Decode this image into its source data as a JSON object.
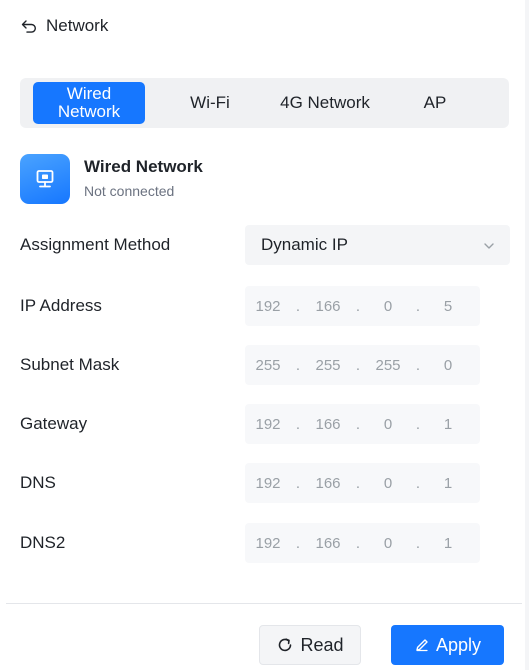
{
  "header": {
    "title": "Network",
    "back_icon": "back-arrow-icon"
  },
  "tabs": [
    {
      "label_line1": "Wired",
      "label_line2": "Network",
      "active": true
    },
    {
      "label": "Wi-Fi",
      "active": false
    },
    {
      "label": "4G Network",
      "active": false
    },
    {
      "label": "AP",
      "active": false
    }
  ],
  "network": {
    "icon": "wired-network-icon",
    "title": "Wired Network",
    "status": "Not connected"
  },
  "assignment": {
    "label": "Assignment Method",
    "value": "Dynamic IP",
    "icon": "chevron-down-icon"
  },
  "fields": [
    {
      "label": "IP Address",
      "octets": [
        "192",
        "166",
        "0",
        "5"
      ]
    },
    {
      "label": "Subnet Mask",
      "octets": [
        "255",
        "255",
        "255",
        "0"
      ]
    },
    {
      "label": "Gateway",
      "octets": [
        "192",
        "166",
        "0",
        "1"
      ]
    },
    {
      "label": "DNS",
      "octets": [
        "192",
        "166",
        "0",
        "1"
      ]
    },
    {
      "label": "DNS2",
      "octets": [
        "192",
        "166",
        "0",
        "1"
      ]
    }
  ],
  "separator": ".",
  "buttons": {
    "read": {
      "label": "Read",
      "icon": "refresh-icon"
    },
    "apply": {
      "label": "Apply",
      "icon": "pencil-icon"
    }
  },
  "colors": {
    "accent": "#1677ff"
  }
}
